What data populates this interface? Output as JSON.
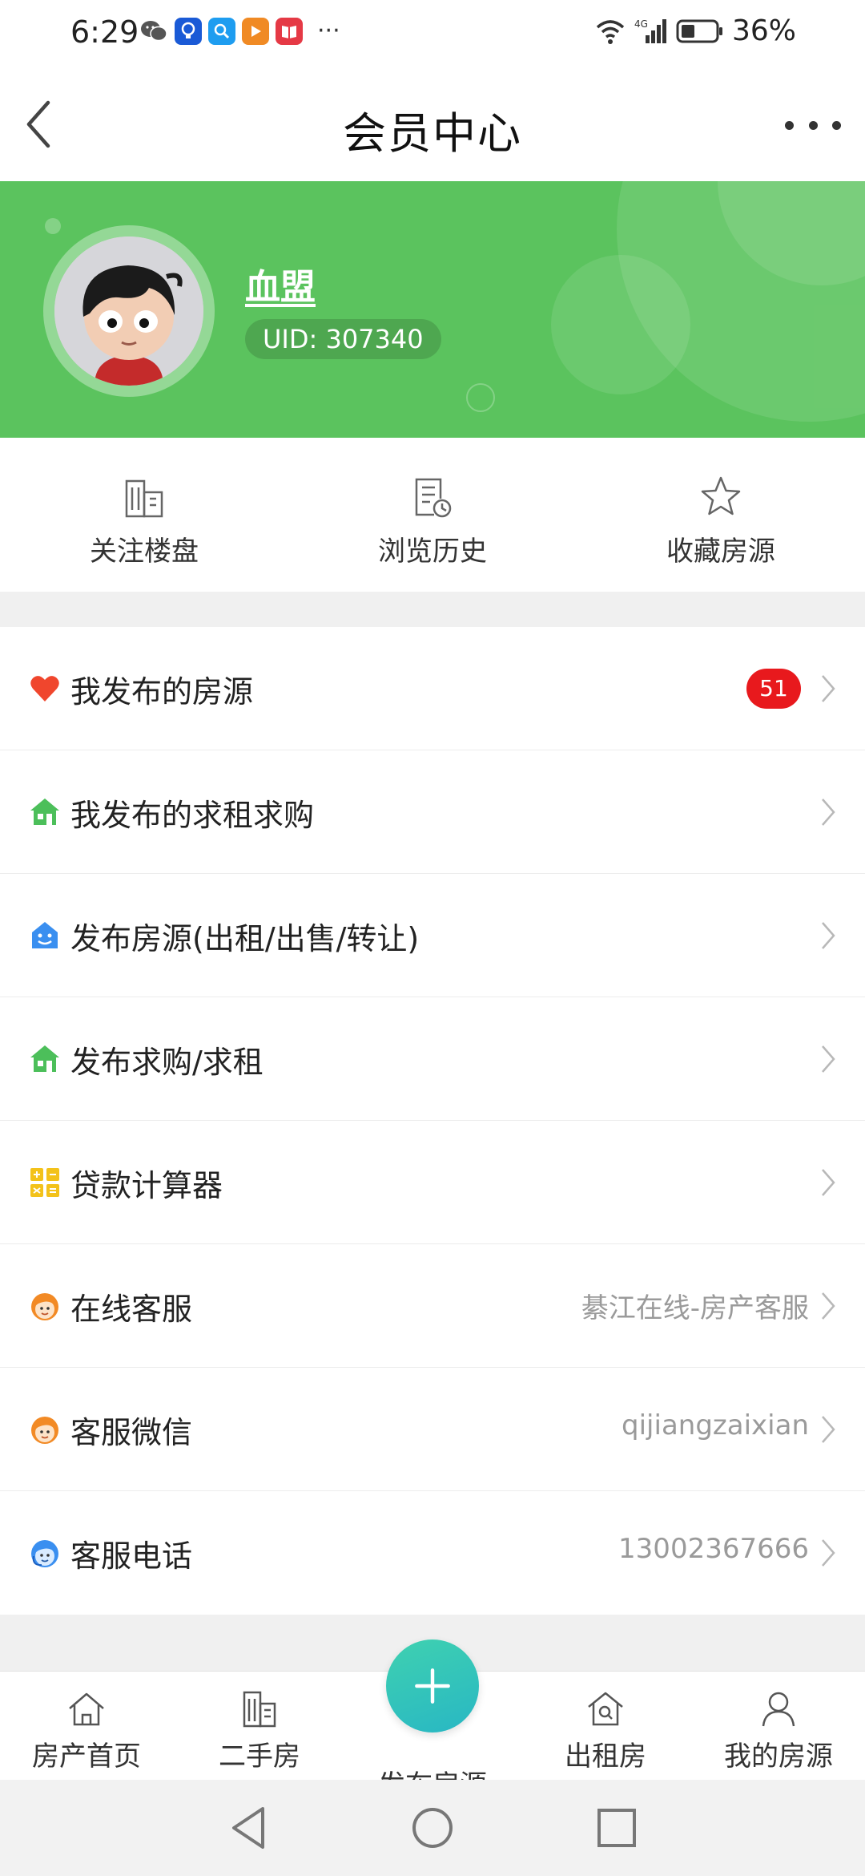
{
  "status_bar": {
    "time": "6:29",
    "more": "···",
    "battery": "36%",
    "network": "4G"
  },
  "nav": {
    "title": "会员中心"
  },
  "profile": {
    "name": "血盟",
    "uid": "UID: 307340"
  },
  "quick_actions": [
    {
      "label": "关注楼盘",
      "icon": "building-icon"
    },
    {
      "label": "浏览历史",
      "icon": "history-icon"
    },
    {
      "label": "收藏房源",
      "icon": "star-icon"
    }
  ],
  "menu": [
    {
      "label": "我发布的房源",
      "badge": "51",
      "icon": "heart-icon",
      "color": "#f0462d"
    },
    {
      "label": "我发布的求租求购",
      "icon": "house-icon",
      "color": "#4cbf5a"
    },
    {
      "label": "发布房源(出租/出售/转让)",
      "icon": "smile-house-icon",
      "color": "#3a8ff0"
    },
    {
      "label": "发布求购/求租",
      "icon": "house-icon",
      "color": "#4cbf5a"
    },
    {
      "label": "贷款计算器",
      "icon": "calculator-icon",
      "color": "#f3c21a"
    },
    {
      "label": "在线客服",
      "value": "綦江在线-房产客服",
      "icon": "service-icon",
      "color": "#f28a25"
    },
    {
      "label": "客服微信",
      "value": "qijiangzaixian",
      "icon": "service-icon",
      "color": "#f28a25"
    },
    {
      "label": "客服电话",
      "value": "13002367666",
      "icon": "headset-icon",
      "color": "#3a8ff0"
    }
  ],
  "tabs": [
    {
      "label": "房产首页",
      "icon": "home-icon"
    },
    {
      "label": "二手房",
      "icon": "building-icon"
    },
    {
      "label": "发布房源",
      "icon": "plus-icon"
    },
    {
      "label": "出租房",
      "icon": "house-search-icon"
    },
    {
      "label": "我的房源",
      "icon": "person-icon"
    }
  ],
  "colors": {
    "brand_green": "#5bc35e",
    "badge_red": "#e8191d",
    "fab_teal": "#33c4bb"
  }
}
